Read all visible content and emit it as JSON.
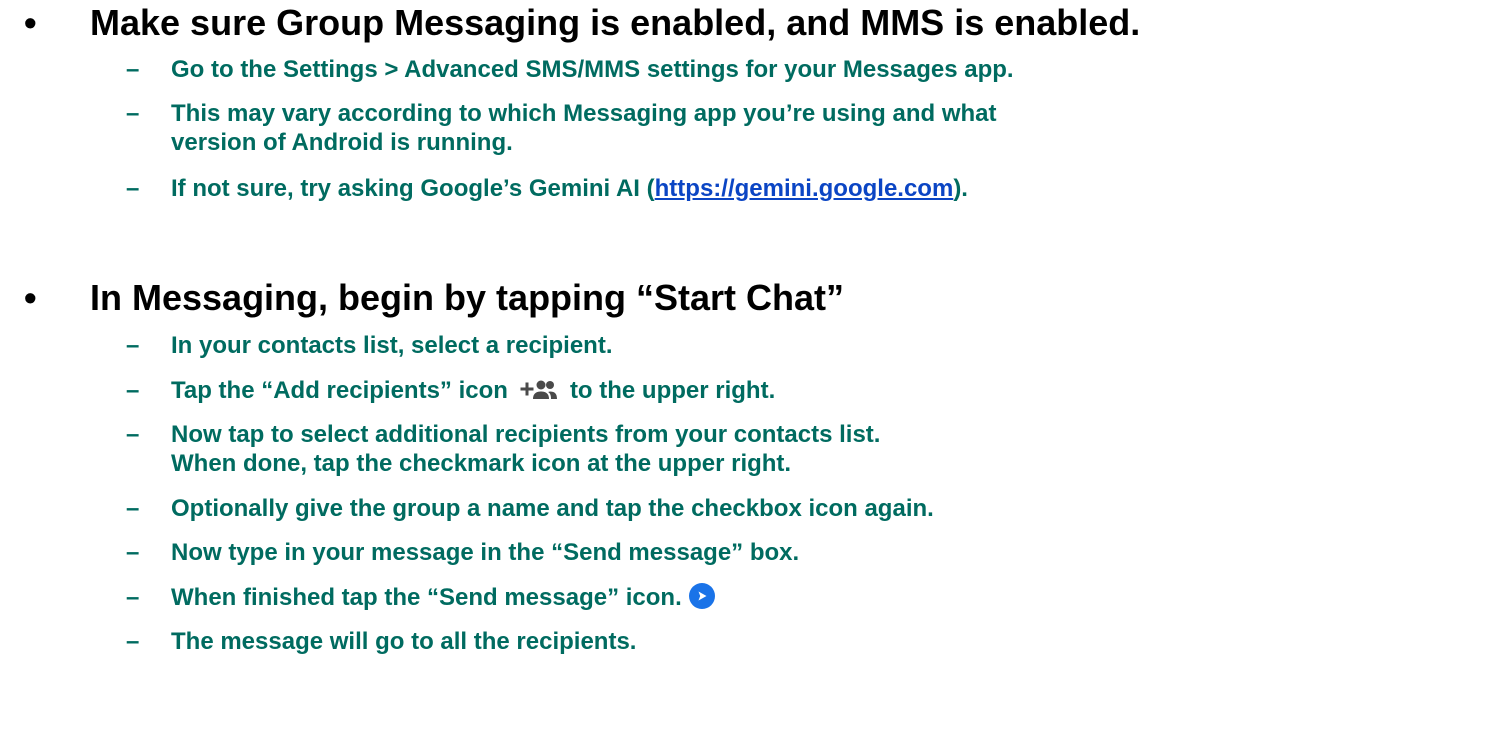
{
  "bullet_glyph": "•",
  "dash_glyph": "–",
  "colors": {
    "heading": "#000000",
    "sub": "#006b60",
    "link": "#0b45c4",
    "icon_gray": "#4a4a4a",
    "send_blue": "#1a73e8"
  },
  "section1": {
    "heading": "Make sure Group Messaging is enabled, and MMS is enabled.",
    "item1": "Go to the Settings > Advanced SMS/MMS settings for your Messages app.",
    "item2_line1": "This may vary according to which Messaging app you’re using and what",
    "item2_line2": "version of Android is running.",
    "item3_before": "If not sure, try asking Google’s Gemini AI (",
    "item3_link": "https://gemini.google.com",
    "item3_after": ")."
  },
  "section2": {
    "heading": "In Messaging, begin by tapping “Start Chat”",
    "item1": "In your contacts list, select a recipient.",
    "item2_before": "Tap the “Add recipients” icon",
    "item2_icon": "add-recipients-icon",
    "item2_after": "to the upper right.",
    "item3_line1": "Now tap to select additional recipients from your contacts list.",
    "item3_line2": "When done, tap the checkmark icon at the upper right.",
    "item4": "Optionally give the group a name and tap the checkbox icon again.",
    "item5": "Now type in your message in the “Send message” box.",
    "item6_text": "When finished tap the “Send message” icon.",
    "item6_icon": "send-message-icon",
    "item7": "The message will go to all the recipients."
  }
}
